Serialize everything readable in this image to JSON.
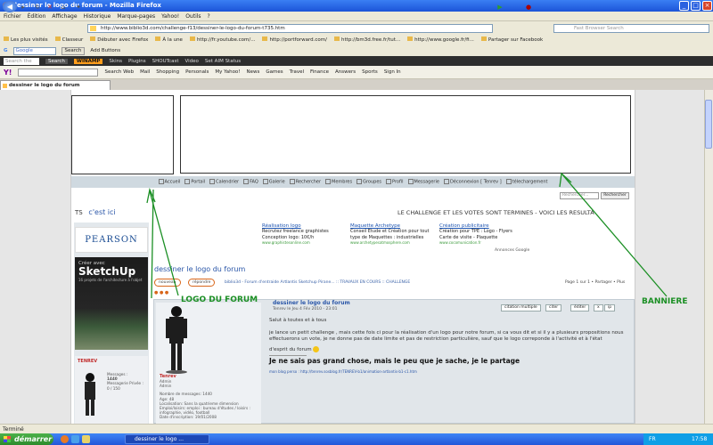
{
  "window": {
    "title": "dessiner le logo du forum - Mozilla Firefox",
    "controls": [
      "_",
      "□",
      "×"
    ]
  },
  "menu": [
    "Fichier",
    "Édition",
    "Affichage",
    "Historique",
    "Marque-pages",
    "Yahoo!",
    "Outils",
    "?"
  ],
  "address": {
    "url": "http://www.biblio3d.com/challenge-f13/dessiner-le-logo-du-forum-t735.htm"
  },
  "search_box": {
    "placeholder": "Fast Browser Search"
  },
  "bookmarks": [
    "Les plus visités",
    "Classeur",
    "Débuter avec Firefox",
    "À la une",
    "http://fr.youtube.com/...",
    "http://portforward.com/",
    "http://bm3d.free.fr/tut...",
    "http://www.google.fr/fi...",
    "Partager sur Facebook"
  ],
  "googlebar": {
    "field": "Google",
    "search": "Search",
    "add": "Add Buttons"
  },
  "winamp": {
    "search": "Search the Web",
    "search_btn": "Search",
    "brand": "WINAMP",
    "items": [
      "Skins",
      "Plugins",
      "SHOUTcast",
      "Video",
      "Set AIM Status"
    ]
  },
  "yahoobar": {
    "logo": "Y!",
    "items": [
      "Search Web",
      "Mail",
      "Shopping",
      "Personals",
      "My Yahoo!",
      "News",
      "Games",
      "Travel",
      "Finance",
      "Answers",
      "Sports",
      "Sign In"
    ]
  },
  "tab": {
    "label": "dessiner le logo du forum"
  },
  "forum": {
    "nav": [
      "Accueil",
      "Portail",
      "Calendrier",
      "FAQ",
      "Galerie",
      "Rechercher",
      "Membres",
      "Groupes",
      "Profil",
      "Messagerie",
      "Déconnexion [ Tenrev ]",
      "télechargement"
    ],
    "search_input": "Rechercher...",
    "search_button": "Rechercher",
    "ts": "TS",
    "ts_word": "c'est ici",
    "marquee": "LE CHALLENGE ET LES VOTES SONT TERMINES - VOICI LES RESULTA",
    "ads": [
      {
        "title": "Réalisation logo",
        "lines": [
          "Recrutez freelance graphistes",
          "Conception logo: 10€/h"
        ],
        "url": "www.graphistesonline.com"
      },
      {
        "title": "Maquette Archetype",
        "lines": [
          "Conseil Etude et Création pour tout",
          "type de Maquettes : industrielles"
        ],
        "url": "www.archetypesatmosphere.com"
      },
      {
        "title": "Création publicitaire",
        "lines": [
          "Création pour TPE : Logo - Flyers",
          "Carte de visite - Plaquette"
        ],
        "url": "www.cocomunication.fr"
      }
    ],
    "ads_by": "Annonces Google",
    "pearson": "PEARSON",
    "book": {
      "top": "Créer avec",
      "title": "SketchUp",
      "sub": "16 projets de l'architecture à l'objet"
    },
    "topic_title": "dessiner le logo du forum",
    "btn_new": "nouveau",
    "btn_reply": "répondre",
    "breadcrumb": "biblio3d - Forum d'entraide Artlantis Sketchup Pirane... :: TRAVAUX EN COURS :: CHALLENGE",
    "page_info": "Page 1 sur 1 • Partager • Plus",
    "post": {
      "title": "dessiner le logo du forum",
      "meta": "Tenrev le Jeu 4 Fév 2010 - 23:01",
      "actions": [
        "citation multiple",
        "citer",
        "éditer",
        "x",
        "ip"
      ],
      "lines": [
        "Salut à toutes et à tous",
        "je lance un petit challenge , mais cette fois ci pour la réalisation d'un logo pour notre forum, si ca vous dit et si il y a plusieurs propositions nous effectuerons un vote, je ne donne pas de date limite et pas de restriction particulière, sauf que le logo correponde à l'activité et à l'état",
        "d'esprit du forum"
      ],
      "signature": "Je ne sais pas grand chose, mais le peu que je sache, je le partage",
      "blog": "mon blog perso : http://tenrev.sosblog.fr/TENREV-b1/animation-artlantis-b1-c1.htm"
    },
    "poster": {
      "name": "Tenrev",
      "rank": "Admin",
      "rank2": "Admin",
      "info": [
        "Nombre de messages: 1440",
        "Age: 48",
        "Localisation: Sans la quatrieme dimension",
        "Emploi/loisirs: emploi : bureau d'études / loisirs : infographie, vidéo, football",
        "Date d'inscription: 19/01/2008"
      ]
    },
    "side_user": {
      "name": "TENREV",
      "messages_label": "Messages :",
      "messages": "1440",
      "pm_label": "Messagerie Privée :",
      "pm": "0 / 150"
    }
  },
  "annotations": {
    "logo": "LOGO DU FORUM",
    "banner": "BANNIERE",
    "color": "#1b8f24"
  },
  "status": "Terminé",
  "taskbar": {
    "start": "démarrer",
    "task": "dessiner le logo ...",
    "lang": "FR",
    "time": "17:58"
  }
}
